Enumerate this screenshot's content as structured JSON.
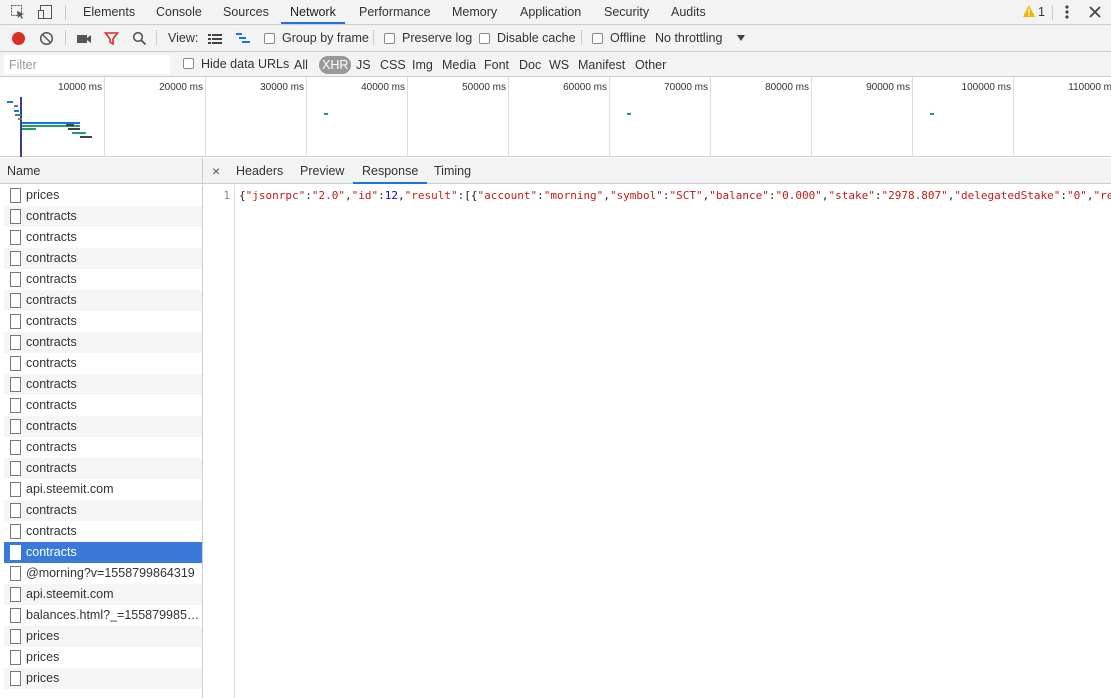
{
  "tabs": [
    "Elements",
    "Console",
    "Sources",
    "Network",
    "Performance",
    "Memory",
    "Application",
    "Security",
    "Audits"
  ],
  "active_tab": "Network",
  "warnings_count": "1",
  "toolbar": {
    "view_label": "View:",
    "group_by_frame": "Group by frame",
    "preserve_log": "Preserve log",
    "disable_cache": "Disable cache",
    "offline": "Offline",
    "throttling": "No throttling"
  },
  "filterbar": {
    "placeholder": "Filter",
    "hide_data_urls": "Hide data URLs",
    "types": [
      "All",
      "XHR",
      "JS",
      "CSS",
      "Img",
      "Media",
      "Font",
      "Doc",
      "WS",
      "Manifest",
      "Other"
    ],
    "active_type": "XHR"
  },
  "timeline": {
    "ticks": [
      "10000 ms",
      "20000 ms",
      "30000 ms",
      "40000 ms",
      "50000 ms",
      "60000 ms",
      "70000 ms",
      "80000 ms",
      "90000 ms",
      "100000 ms",
      "110000 m"
    ]
  },
  "requests": {
    "header": "Name",
    "items": [
      "prices",
      "contracts",
      "contracts",
      "contracts",
      "contracts",
      "contracts",
      "contracts",
      "contracts",
      "contracts",
      "contracts",
      "contracts",
      "contracts",
      "contracts",
      "contracts",
      "api.steemit.com",
      "contracts",
      "contracts",
      "contracts",
      "@morning?v=1558799864319",
      "api.steemit.com",
      "balances.html?_=1558799858...",
      "prices",
      "prices",
      "prices"
    ],
    "selected_index": 17
  },
  "detail": {
    "close": "×",
    "tabs": [
      "Headers",
      "Preview",
      "Response",
      "Timing"
    ],
    "active_tab": "Response",
    "line_number": "1",
    "response_line": "{\"jsonrpc\":\"2.0\",\"id\":12,\"result\":[{\"account\":\"morning\",\"symbol\":\"SCT\",\"balance\":\"0.000\",\"stake\":\"2978.807\",\"delegatedStake\":\"0\",\"re"
  },
  "colors": {
    "accent": "#1a73e8",
    "record": "#d93025",
    "selected_row": "#3879d9",
    "filter_icon": "#d93025",
    "warning": "#f4b400"
  }
}
